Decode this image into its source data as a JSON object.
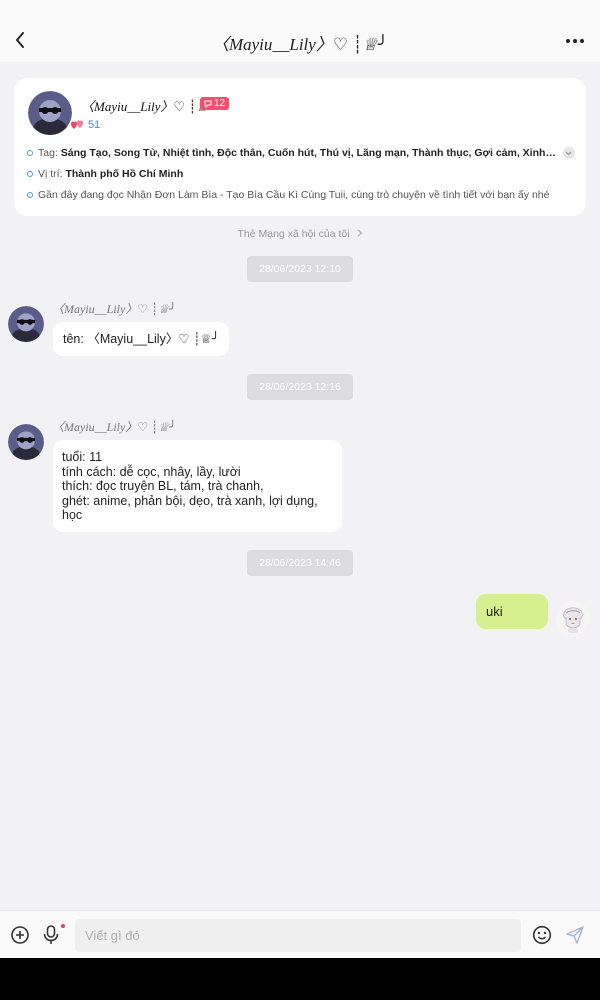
{
  "header": {
    "title": "〈Mayiu__Lily〉♡ ┊♕╯"
  },
  "profile": {
    "name": "〈Mayiu__Lily〉♡ ┊♕╯",
    "badge_count": "12",
    "hearts_count": "51",
    "tags_label": "Tag:",
    "tags_value": "Sáng Tạo, Song Tử, Nhiệt tình, Độc thân, Cuốn hút, Thú vị, Lãng mạn, Thành thục, Gợi cảm, Xinh đẹp, Đán...",
    "location_label": "Vị trí:",
    "location_value": "Thành phố Hồ Chí Minh",
    "reading_text": "Gần đây đang đọc Nhận Đơn Làm Bìa - Tạo Bìa Cầu Kì Cùng Tuii, cùng trò chuyện về tình tiết với bạn ấy nhé"
  },
  "social_link": "Thẻ Mạng xã hội của tôi",
  "messages": [
    {
      "time": "28/06/2023 12:10",
      "sender": "〈Mayiu__Lily〉♡ ┊♕╯",
      "text": "tên: 〈Mayiu__Lily〉♡ ┊♕╯"
    },
    {
      "time": "28/06/2023 12:16",
      "sender": "〈Mayiu__Lily〉♡ ┊♕╯",
      "text": "tuổi: 11\ntính cách: dễ cọc, nhây, lầy, lười\nthích: đọc truyện BL, tám, trà chanh,\nghét: anime, phản bội, dẹo, trà xanh, lợi dụng, học"
    },
    {
      "time": "28/06/2023 14:46",
      "text": "uki"
    }
  ],
  "input": {
    "placeholder": "Viết gì đó"
  },
  "colors": {
    "outgoing_bubble": "#d6ef8f",
    "badge": "#f0506e",
    "accent_blue": "#3d8be6"
  },
  "icons": [
    "back-arrow-icon",
    "more-icon",
    "message-icon",
    "hearts-icon",
    "chevron-right-icon",
    "chevron-down-icon",
    "plus-circle-icon",
    "microphone-icon",
    "emoji-icon",
    "send-icon"
  ]
}
